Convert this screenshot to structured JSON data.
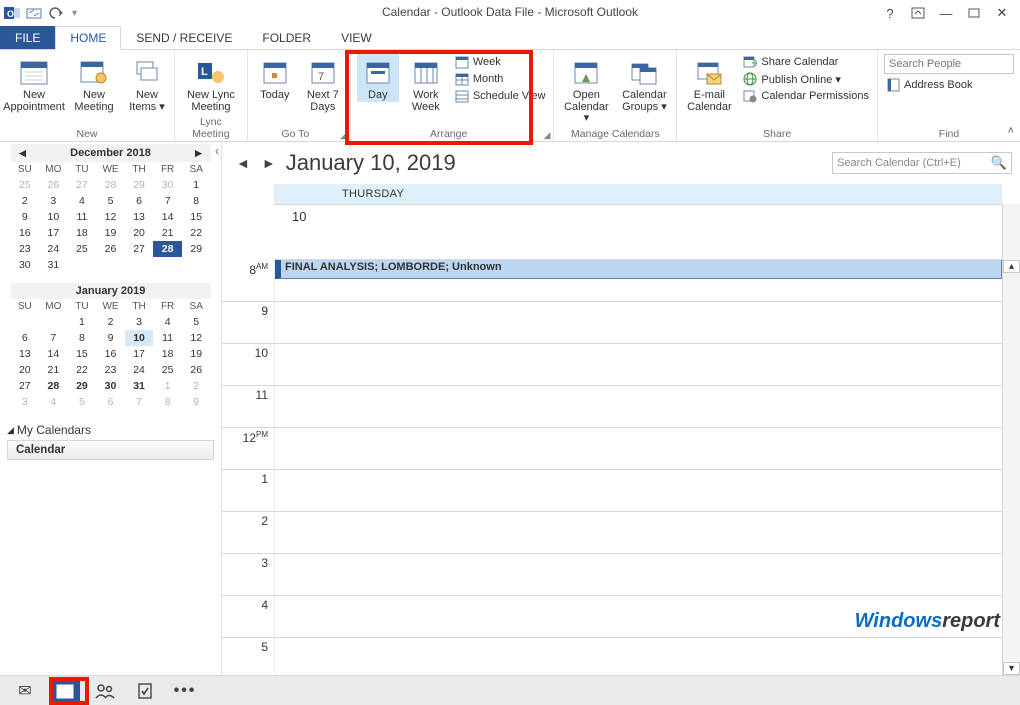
{
  "title": "Calendar - Outlook Data File - Microsoft Outlook",
  "menu": {
    "file": "FILE",
    "home": "HOME",
    "sendreceive": "SEND / RECEIVE",
    "folder": "FOLDER",
    "view": "VIEW"
  },
  "ribbon": {
    "new": {
      "appointment": "New\nAppointment",
      "meeting": "New\nMeeting",
      "items": "New\nItems ▾",
      "label": "New"
    },
    "lync": {
      "btn": "New Lync\nMeeting",
      "label": "Lync Meeting"
    },
    "goto": {
      "today": "Today",
      "next7": "Next 7\nDays",
      "label": "Go To"
    },
    "arrange": {
      "day": "Day",
      "workweek": "Work\nWeek",
      "week": "Week",
      "month": "Month",
      "schedule": "Schedule View",
      "label": "Arrange"
    },
    "manage": {
      "open": "Open\nCalendar ▾",
      "groups": "Calendar\nGroups ▾",
      "label": "Manage Calendars"
    },
    "share": {
      "email": "E-mail\nCalendar",
      "sharecal": "Share Calendar",
      "publish": "Publish Online ▾",
      "permissions": "Calendar Permissions",
      "label": "Share"
    },
    "find": {
      "search_placeholder": "Search People",
      "addressbook": "Address Book",
      "label": "Find"
    }
  },
  "minical1": {
    "title": "December 2018",
    "dow": [
      "SU",
      "MO",
      "TU",
      "WE",
      "TH",
      "FR",
      "SA"
    ],
    "days": [
      [
        "25",
        "d"
      ],
      [
        "26",
        "d"
      ],
      [
        "27",
        "d"
      ],
      [
        "28",
        "d"
      ],
      [
        "29",
        "d"
      ],
      [
        "30",
        "d"
      ],
      [
        "1",
        ""
      ],
      [
        "2",
        ""
      ],
      [
        "3",
        ""
      ],
      [
        "4",
        ""
      ],
      [
        "5",
        ""
      ],
      [
        "6",
        ""
      ],
      [
        "7",
        ""
      ],
      [
        "8",
        ""
      ],
      [
        "9",
        ""
      ],
      [
        "10",
        ""
      ],
      [
        "11",
        ""
      ],
      [
        "12",
        ""
      ],
      [
        "13",
        ""
      ],
      [
        "14",
        ""
      ],
      [
        "15",
        ""
      ],
      [
        "16",
        ""
      ],
      [
        "17",
        ""
      ],
      [
        "18",
        ""
      ],
      [
        "19",
        ""
      ],
      [
        "20",
        ""
      ],
      [
        "21",
        ""
      ],
      [
        "22",
        ""
      ],
      [
        "23",
        ""
      ],
      [
        "24",
        ""
      ],
      [
        "25",
        ""
      ],
      [
        "26",
        ""
      ],
      [
        "27",
        ""
      ],
      [
        "28",
        "sel"
      ],
      [
        "29",
        ""
      ],
      [
        "30",
        ""
      ],
      [
        "31",
        ""
      ],
      [
        "",
        "x"
      ],
      [
        "",
        "x"
      ],
      [
        "",
        "x"
      ],
      [
        "",
        "x"
      ],
      [
        "",
        "x"
      ]
    ]
  },
  "minical2": {
    "title": "January 2019",
    "dow": [
      "SU",
      "MO",
      "TU",
      "WE",
      "TH",
      "FR",
      "SA"
    ],
    "days": [
      [
        "",
        "x"
      ],
      [
        "",
        "x"
      ],
      [
        "1",
        ""
      ],
      [
        "2",
        ""
      ],
      [
        "3",
        ""
      ],
      [
        "4",
        ""
      ],
      [
        "5",
        ""
      ],
      [
        "6",
        ""
      ],
      [
        "7",
        ""
      ],
      [
        "8",
        ""
      ],
      [
        "9",
        ""
      ],
      [
        "10",
        "today bold"
      ],
      [
        "11",
        ""
      ],
      [
        "12",
        ""
      ],
      [
        "13",
        ""
      ],
      [
        "14",
        ""
      ],
      [
        "15",
        ""
      ],
      [
        "16",
        ""
      ],
      [
        "17",
        ""
      ],
      [
        "18",
        ""
      ],
      [
        "19",
        ""
      ],
      [
        "20",
        ""
      ],
      [
        "21",
        ""
      ],
      [
        "22",
        ""
      ],
      [
        "23",
        ""
      ],
      [
        "24",
        ""
      ],
      [
        "25",
        ""
      ],
      [
        "26",
        ""
      ],
      [
        "27",
        ""
      ],
      [
        "28",
        "bold"
      ],
      [
        "29",
        "bold"
      ],
      [
        "30",
        "bold"
      ],
      [
        "31",
        "bold"
      ],
      [
        "1",
        "d"
      ],
      [
        "2",
        "d"
      ],
      [
        "3",
        "d"
      ],
      [
        "4",
        "d"
      ],
      [
        "5",
        "d"
      ],
      [
        "6",
        "d"
      ],
      [
        "7",
        "d"
      ],
      [
        "8",
        "d"
      ],
      [
        "9",
        "d"
      ]
    ]
  },
  "mycal": {
    "header": "My Calendars",
    "item": "Calendar"
  },
  "calpane": {
    "date": "January 10, 2019",
    "search_placeholder": "Search Calendar (Ctrl+E)",
    "dayname": "THURSDAY",
    "daynum": "10",
    "hours": [
      "8 AM",
      "9",
      "10",
      "11",
      "12 PM",
      "1",
      "2",
      "3",
      "4",
      "5"
    ],
    "appt": "FINAL ANALYSIS; LOMBORDE; Unknown"
  },
  "watermark": {
    "a": "Windows",
    "b": "report"
  }
}
